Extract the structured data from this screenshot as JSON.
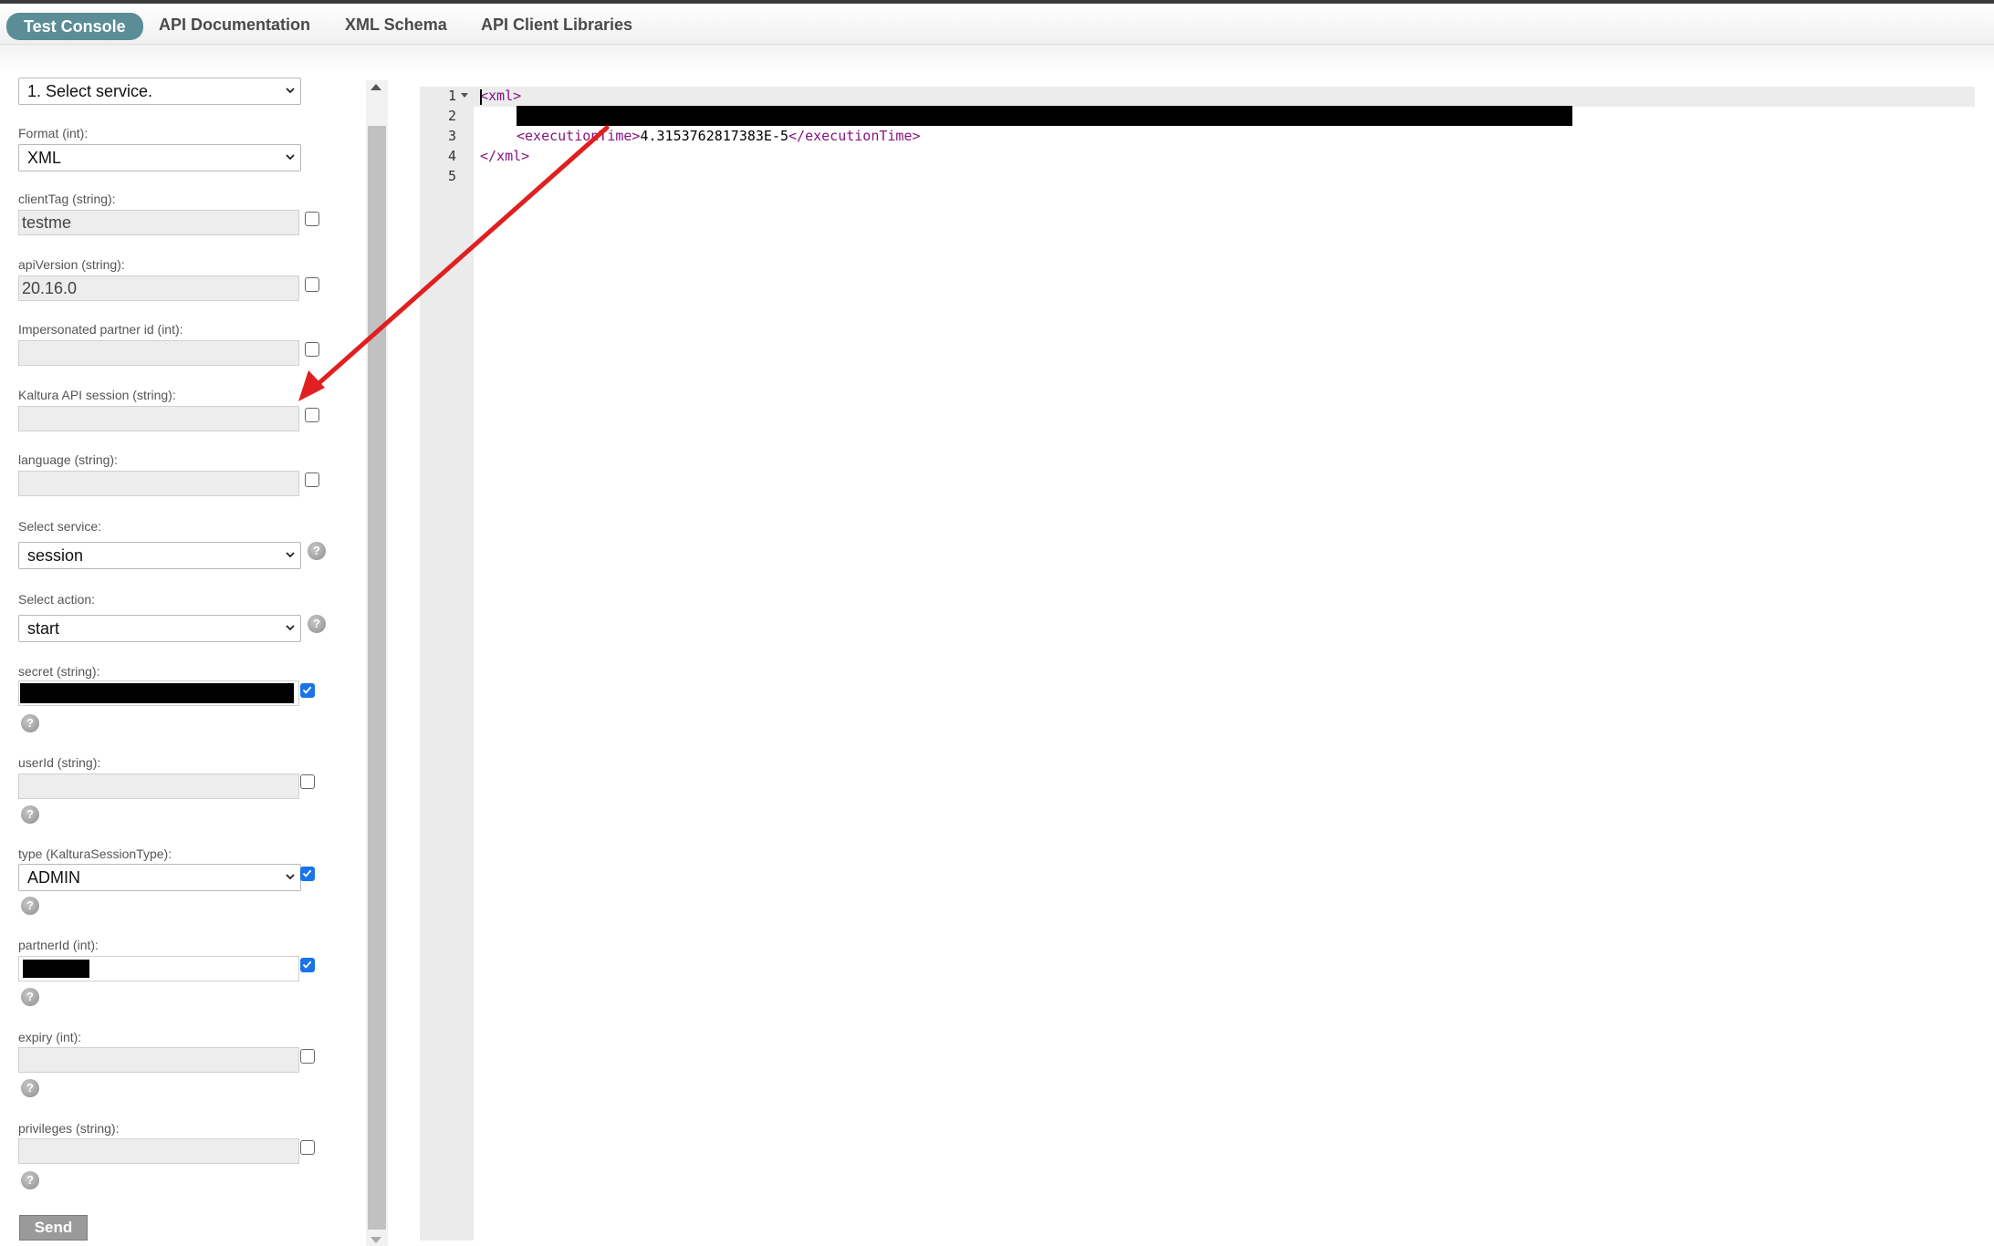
{
  "tabs": [
    {
      "label": "Test Console",
      "active": true
    },
    {
      "label": "API Documentation",
      "active": false
    },
    {
      "label": "XML Schema",
      "active": false
    },
    {
      "label": "API Client Libraries",
      "active": false
    }
  ],
  "form": {
    "service_selector": "1. Select service.",
    "format": {
      "label": "Format (int):",
      "value": "XML"
    },
    "clientTag": {
      "label": "clientTag (string):",
      "value": "testme",
      "checked": false
    },
    "apiVersion": {
      "label": "apiVersion (string):",
      "value": "20.16.0",
      "checked": false
    },
    "impersonatedPartner": {
      "label": "Impersonated partner id (int):",
      "value": "",
      "checked": false
    },
    "ks": {
      "label": "Kaltura API session (string):",
      "value": "",
      "checked": false
    },
    "language": {
      "label": "language (string):",
      "value": "",
      "checked": false
    },
    "selectService": {
      "label": "Select service:",
      "value": "session"
    },
    "selectAction": {
      "label": "Select action:",
      "value": "start"
    },
    "secret": {
      "label": "secret (string):",
      "checked": true
    },
    "userId": {
      "label": "userId (string):",
      "value": "",
      "checked": false
    },
    "type": {
      "label": "type (KalturaSessionType):",
      "value": "ADMIN",
      "checked": true
    },
    "partnerId": {
      "label": "partnerId (int):",
      "checked": true
    },
    "expiry": {
      "label": "expiry (int):",
      "value": "",
      "checked": false
    },
    "privileges": {
      "label": "privileges (string):",
      "value": "",
      "checked": false
    },
    "help_glyph": "?",
    "send_label": "Send"
  },
  "editor": {
    "line_numbers": [
      "1",
      "2",
      "3",
      "4",
      "5"
    ],
    "line1_tag": "<xml>",
    "line3_open": "<executionTime>",
    "line3_value": "4.3153762817383E-5",
    "line3_close": "</executionTime>",
    "line4_tag": "</xml>"
  },
  "colors": {
    "active_tab": "#5b8d96",
    "xml_tag": "#881280",
    "annotation_arrow": "#e02020",
    "checkbox_checked": "#1a73e8"
  }
}
